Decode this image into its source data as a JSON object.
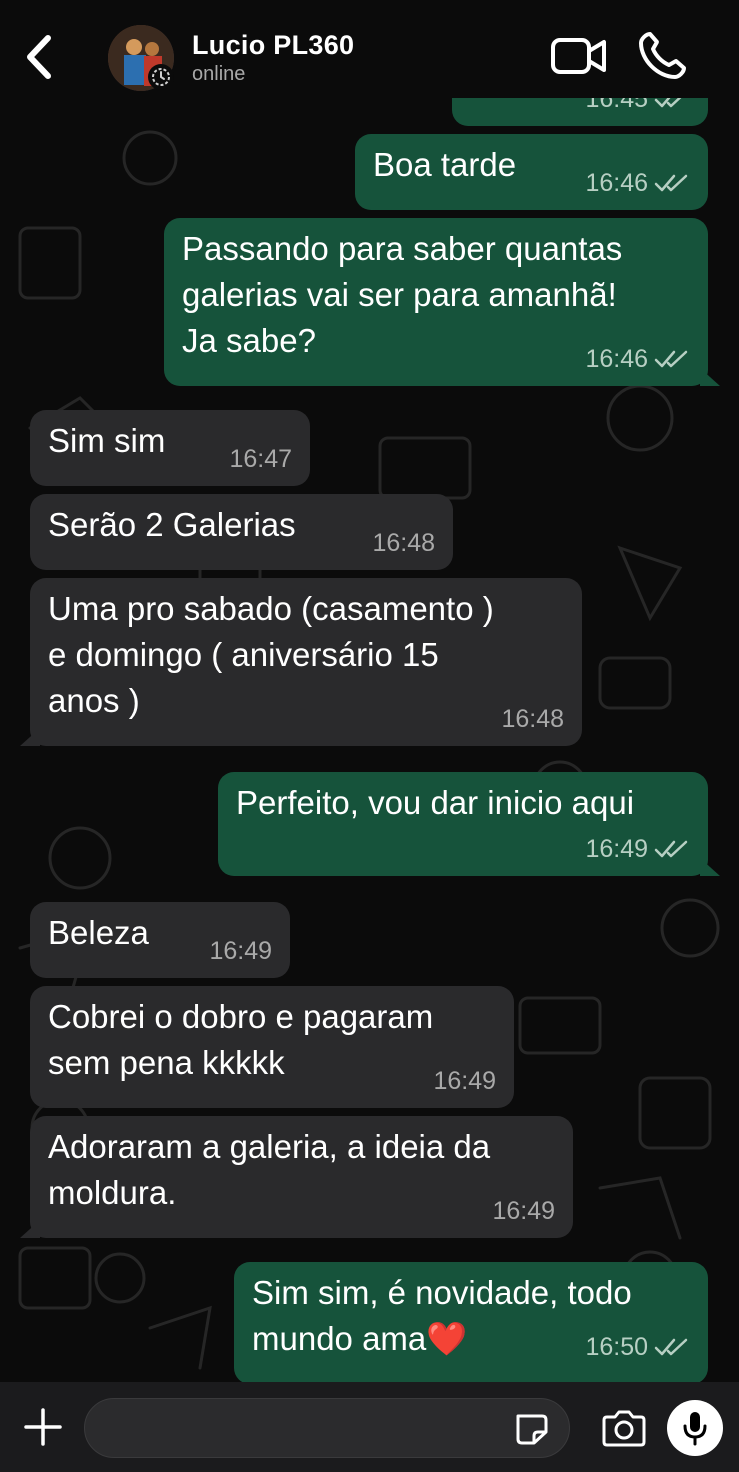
{
  "header": {
    "contact_name": "Lucio PL360",
    "status": "online",
    "icons": {
      "back": "chevron-left-icon",
      "video": "video-camera-icon",
      "call": "phone-icon",
      "avatar_badge": "disappearing-timer-icon"
    }
  },
  "messages": [
    {
      "direction": "out",
      "text": "",
      "time": "16:45",
      "ticks": "read"
    },
    {
      "direction": "out",
      "text": "Boa tarde",
      "time": "16:46",
      "ticks": "read"
    },
    {
      "direction": "out",
      "text": "Passando para saber quantas\ngalerias vai ser para amanhã!\nJa sabe?",
      "time": "16:46",
      "ticks": "read"
    },
    {
      "direction": "in",
      "text": "Sim sim",
      "time": "16:47"
    },
    {
      "direction": "in",
      "text": "Serão 2 Galerias",
      "time": "16:48"
    },
    {
      "direction": "in",
      "text": "Uma pro sabado (casamento )\ne domingo ( aniversário 15\nanos )",
      "time": "16:48"
    },
    {
      "direction": "out",
      "text": "Perfeito, vou dar inicio aqui",
      "time": "16:49",
      "ticks": "read"
    },
    {
      "direction": "in",
      "text": "Beleza",
      "time": "16:49"
    },
    {
      "direction": "in",
      "text": "Cobrei o dobro e pagaram\nsem pena kkkkk",
      "time": "16:49"
    },
    {
      "direction": "in",
      "text": "Adoraram a galeria, a ideia da\nmoldura.",
      "time": "16:49"
    },
    {
      "direction": "out",
      "text": "Sim sim, é novidade, todo\nmundo ama❤️",
      "time": "16:50",
      "ticks": "read"
    }
  ],
  "input_bar": {
    "placeholder": "",
    "icons": {
      "plus": "plus-icon",
      "sticker": "sticker-icon",
      "camera": "camera-icon",
      "mic": "microphone-icon"
    }
  },
  "colors": {
    "outgoing_bubble": "#16533b",
    "incoming_bubble": "#2a2a2c",
    "background": "#0b0b0b"
  }
}
